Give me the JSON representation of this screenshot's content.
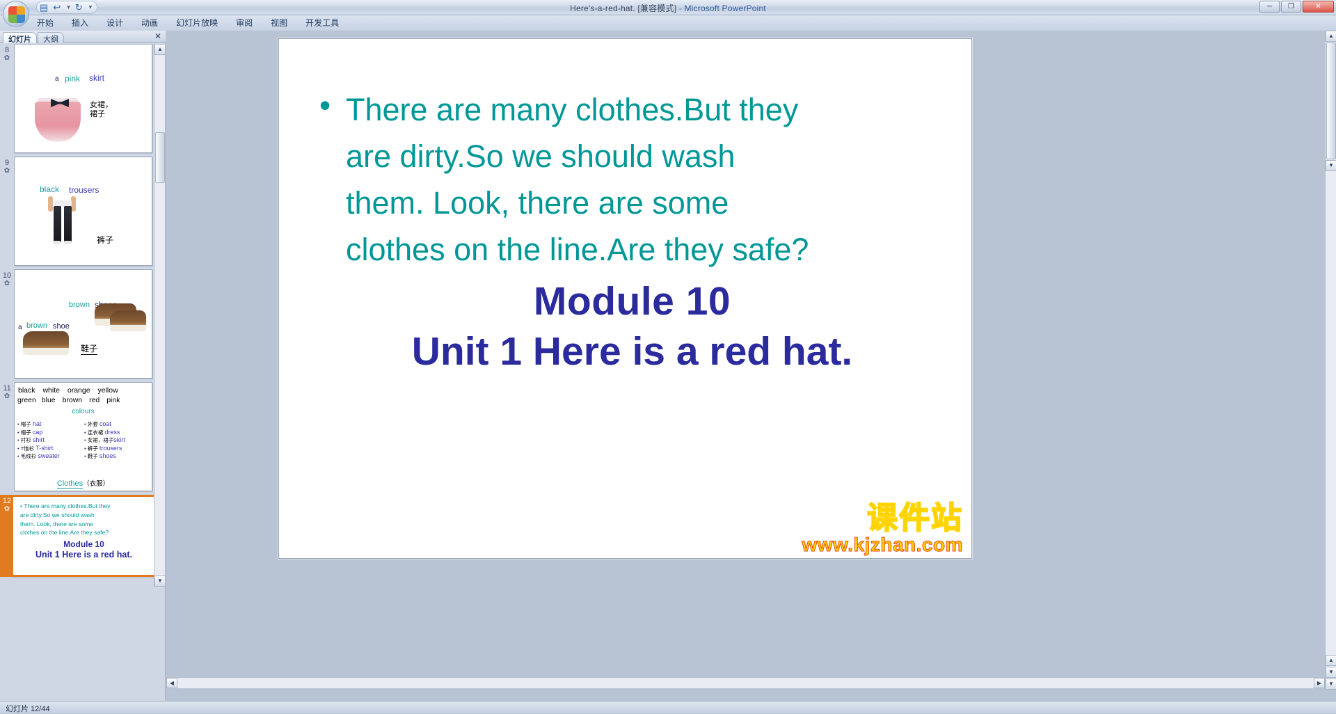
{
  "window": {
    "title_doc": "Here's-a-red-hat. [兼容模式]",
    "title_dash": " - ",
    "title_app": "Microsoft PowerPoint",
    "minimize": "─",
    "maximize": "❐",
    "close": "✕"
  },
  "quick_access": {
    "save_icon": "save-icon",
    "undo_icon": "undo-icon",
    "redo_icon": "redo-icon",
    "more_icon": "more-icon",
    "save_glyph": "▤",
    "undo_glyph": "↩",
    "undo_caret": "▾",
    "redo_glyph": "↻",
    "more_glyph": "▾"
  },
  "ribbon": {
    "tabs": [
      {
        "label": "开始"
      },
      {
        "label": "插入"
      },
      {
        "label": "设计"
      },
      {
        "label": "动画"
      },
      {
        "label": "幻灯片放映"
      },
      {
        "label": "审阅"
      },
      {
        "label": "视图"
      },
      {
        "label": "开发工具"
      }
    ]
  },
  "left_pane": {
    "tabs": [
      {
        "label": "幻灯片",
        "active": true
      },
      {
        "label": "大纲",
        "active": false
      }
    ],
    "close_glyph": "✕",
    "star_glyph": "✿",
    "thumbnails": [
      {
        "number": "8",
        "words": [
          {
            "text": "a",
            "color": "dark"
          },
          {
            "text": "pink",
            "color": "teal"
          },
          {
            "text": "skirt",
            "color": "blue"
          }
        ],
        "chinese": [
          "女裙，",
          "裙子"
        ]
      },
      {
        "number": "9",
        "words": [
          {
            "text": "black",
            "color": "teal"
          },
          {
            "text": "trousers",
            "color": "blue"
          }
        ],
        "chinese": [
          "裤子"
        ]
      },
      {
        "number": "10",
        "words": [
          {
            "text": "brown",
            "color": "teal"
          },
          {
            "text": "shoes",
            "color": "dark"
          },
          {
            "text": "a",
            "color": "dark"
          },
          {
            "text": "brown",
            "color": "teal"
          },
          {
            "text": "shoe",
            "color": "dark"
          }
        ],
        "chinese": [
          "鞋子"
        ]
      },
      {
        "number": "11",
        "colour_row1": [
          "black",
          "white",
          "orange",
          "yellow"
        ],
        "colour_row2": [
          "green",
          "blue",
          "brown",
          "red",
          "pink"
        ],
        "colours_label": "colours",
        "left_items": [
          {
            "cn": "帽子",
            "en": "hat"
          },
          {
            "cn": "帽子",
            "en": "cap"
          },
          {
            "cn": "衬衫",
            "en": "shirt"
          },
          {
            "cn": "T恤衫",
            "en": "T-shirt"
          },
          {
            "cn": "毛线衫",
            "en": "sweater"
          }
        ],
        "right_items": [
          {
            "cn": "外套",
            "en": "coat"
          },
          {
            "cn": "连衣裙",
            "en": "dress"
          },
          {
            "cn": "女裙，裙子",
            "en": "skirt"
          },
          {
            "cn": "裤子",
            "en": "trousers"
          },
          {
            "cn": "鞋子",
            "en": "shoes"
          }
        ],
        "footer_en": "Clothes",
        "footer_cn": "（衣服）"
      },
      {
        "number": "12",
        "selected": true,
        "body_lines": [
          "There  are  many  clothes.But they",
          "are   dirty.So we should wash",
          "them. Look, there  are  some",
          "clothes on the line.Are they safe?"
        ],
        "module_line": "Module 10",
        "unit_line": "Unit 1 Here  is a red hat."
      }
    ]
  },
  "slide": {
    "bullet_glyph": "•",
    "body_lines": [
      "There are many clothes.But they",
      "are  dirty.So we should wash",
      "them. Look, there are some",
      "clothes on the line.Are they safe?"
    ],
    "module_line": "Module 10",
    "unit_line": "Unit 1 Here  is a red hat.",
    "body_color": "#009797",
    "heading_color": "#2b2b9e"
  },
  "watermark": {
    "brand_cn": "课件站",
    "brand_url": "www.kjzhan.com",
    "brand_color": "#e8491d",
    "outline_color": "#ffd400"
  },
  "scrollbars": {
    "up_glyph": "▲",
    "down_glyph": "▼",
    "left_glyph": "◀",
    "right_glyph": "▶"
  },
  "status": {
    "slide_counter": "幻灯片 12/44"
  }
}
